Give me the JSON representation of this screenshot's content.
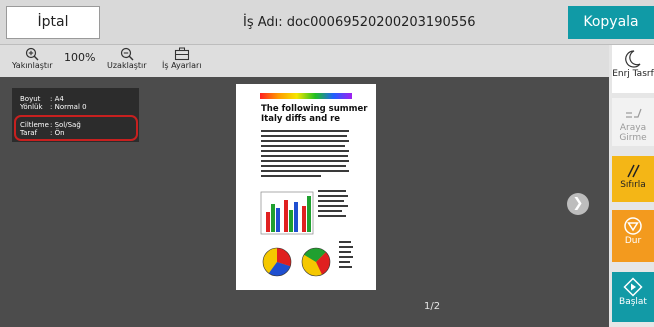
{
  "header": {
    "cancel_label": "İptal",
    "job_name": "İş Adı:  doc00069520200203190556",
    "copy_label": "Kopyala"
  },
  "toolbar": {
    "zoom_in_label": "Yakınlaştır",
    "zoom_level": "100%",
    "zoom_out_label": "Uzaklaştır",
    "job_settings_label": "İş Ayarları"
  },
  "info": {
    "rows": [
      {
        "key": "Boyut",
        "value": ": A4"
      },
      {
        "key": "Yönlük",
        "value": ": Normal 0"
      },
      {
        "key": "Ciltleme",
        "value": ": Sol/Sağ"
      },
      {
        "key": "Taraf",
        "value": ": Ön"
      }
    ]
  },
  "document": {
    "heading_line1": "The following summer",
    "heading_line2": "Italy diffs and re"
  },
  "pager": {
    "label": "1/2"
  },
  "sidebar": {
    "energy_saver_label": "Enrj Tasrf",
    "interrupt_label": "Araya Girme",
    "reset_label": "Sıfırla",
    "stop_label": "Dur",
    "start_label": "Başlat"
  },
  "colors": {
    "accent": "#109aa6",
    "reset": "#f4b616",
    "stop": "#f39a1e",
    "start": "#129aa6",
    "highlight": "#c8201f"
  }
}
